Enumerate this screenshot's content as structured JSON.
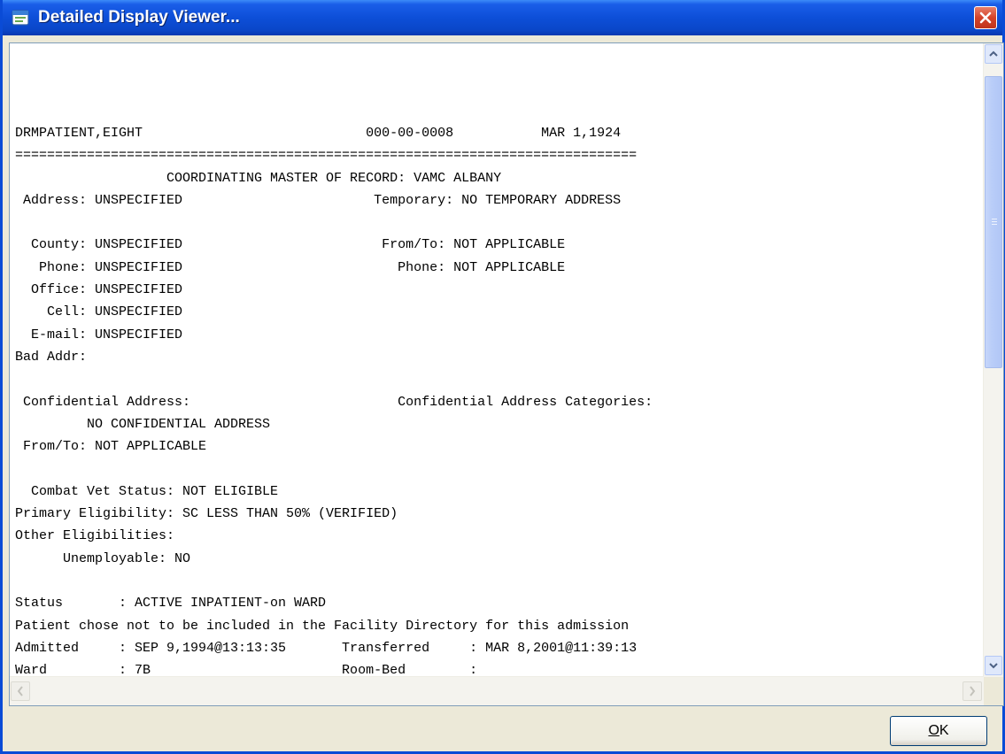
{
  "window": {
    "title": "Detailed Display Viewer...",
    "title_icon": "app-window-icon",
    "close_icon": "close-icon"
  },
  "report": {
    "lines": [
      "DRMPATIENT,EIGHT                            000-00-0008           MAR 1,1924",
      "==============================================================================",
      "                   COORDINATING MASTER OF RECORD: VAMC ALBANY",
      " Address: UNSPECIFIED                        Temporary: NO TEMPORARY ADDRESS",
      "",
      "  County: UNSPECIFIED                         From/To: NOT APPLICABLE",
      "   Phone: UNSPECIFIED                           Phone: NOT APPLICABLE",
      "  Office: UNSPECIFIED",
      "    Cell: UNSPECIFIED",
      "  E-mail: UNSPECIFIED",
      "Bad Addr:",
      "",
      " Confidential Address:                          Confidential Address Categories:",
      "         NO CONFIDENTIAL ADDRESS",
      " From/To: NOT APPLICABLE",
      "",
      "  Combat Vet Status: NOT ELIGIBLE",
      "Primary Eligibility: SC LESS THAN 50% (VERIFIED)",
      "Other Eligibilities:",
      "      Unemployable: NO",
      "",
      "Status       : ACTIVE INPATIENT-on WARD",
      "Patient chose not to be included in the Facility Directory for this admission",
      "Admitted     : SEP 9,1994@13:13:35       Transferred     : MAR 8,2001@11:39:13",
      "Ward         : 7B                        Room-Bed        :"
    ]
  },
  "buttons": {
    "ok_label": "OK"
  },
  "colors": {
    "titlebar": "#0a4bd6",
    "close_button": "#d4432a",
    "dialog_background": "#ece9d8"
  }
}
